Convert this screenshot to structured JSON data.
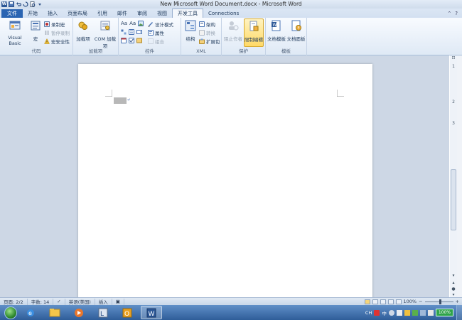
{
  "window": {
    "title": "New Microsoft Word Document.docx - Microsoft Word"
  },
  "quick_access": {
    "icons": [
      "word-logo-icon",
      "save-icon",
      "undo-icon",
      "redo-icon",
      "print-preview-icon",
      "customize-qat-icon"
    ]
  },
  "tabs": [
    {
      "label": "文件",
      "kind": "file"
    },
    {
      "label": "开始"
    },
    {
      "label": "插入"
    },
    {
      "label": "页面布局"
    },
    {
      "label": "引用"
    },
    {
      "label": "邮件"
    },
    {
      "label": "审阅"
    },
    {
      "label": "视图"
    },
    {
      "label": "开发工具",
      "active": true
    },
    {
      "label": "Connections"
    }
  ],
  "ribbon": {
    "groups": {
      "code": {
        "label": "代码",
        "visual_basic": "Visual Basic",
        "macro": "宏",
        "record_macro": "录制宏",
        "pause_recording": "暂停录制",
        "macro_security": "宏安全性"
      },
      "addins": {
        "label": "加载项",
        "addins": "加载项",
        "com_addins": "COM 加载项"
      },
      "controls": {
        "label": "控件",
        "design_mode": "设计模式",
        "properties": "属性",
        "group": "组合"
      },
      "xml": {
        "label": "XML",
        "structure": "结构",
        "schema": "架构",
        "transform": "转换",
        "expansion_pack": "扩展包"
      },
      "protect": {
        "label": "保护",
        "block_authors": "阻止作者",
        "restrict_editing": "限制编辑"
      },
      "templates": {
        "label": "模板",
        "document_template": "文档模板",
        "document_panel": "文档面板"
      }
    }
  },
  "status": {
    "page": "页面: 2/2",
    "words": "字数: 14",
    "language": "英语(美国)",
    "mode": "插入",
    "zoom": "100%"
  },
  "taskbar": {
    "items": [
      "ie-icon",
      "explorer-icon",
      "media-player-icon",
      "onenote-icon",
      "outlook-icon",
      "word-icon"
    ],
    "tray": {
      "lang": "CH",
      "ime": "中",
      "battery": "100%"
    }
  },
  "ruler": {
    "labels": [
      "1",
      "2",
      "3"
    ]
  },
  "colors": {
    "file_tab": "#2a64b2",
    "active_tab_bg": "#f5f8fc",
    "doc_bg": "#cdd7e5",
    "taskbar": "#3a6ba8"
  }
}
